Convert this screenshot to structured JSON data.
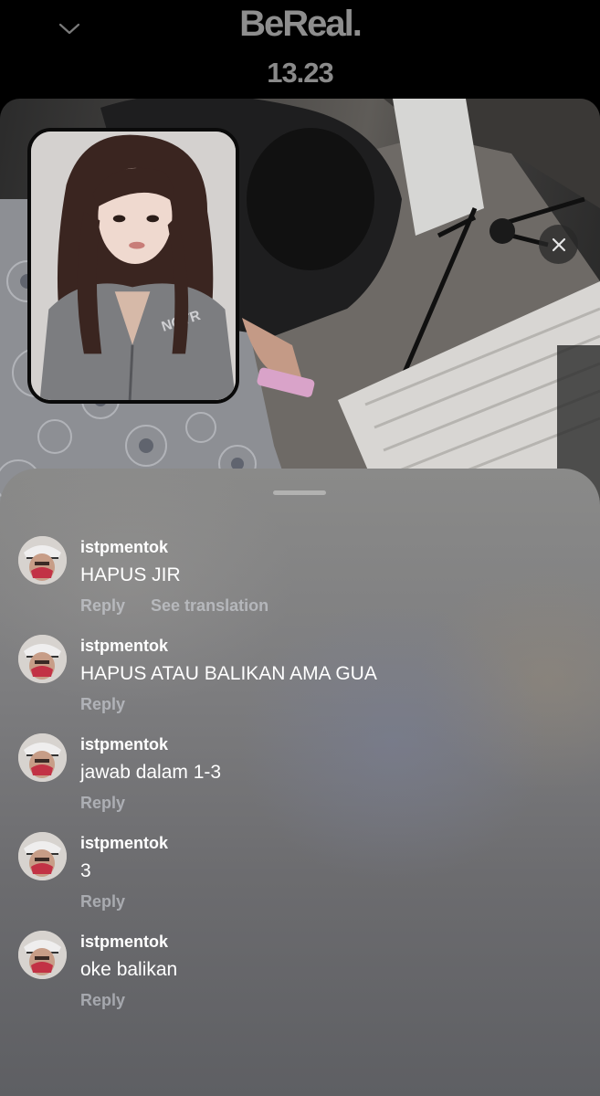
{
  "header": {
    "brand": "BeReal.",
    "time": "13.23",
    "collapse_icon": "chevron-down-icon"
  },
  "photo": {
    "close_icon": "close-icon"
  },
  "comments": [
    {
      "username": "istpmentok",
      "text": "HAPUS JIR",
      "reply": "Reply",
      "translate": "See translation"
    },
    {
      "username": "istpmentok",
      "text": "HAPUS ATAU BALIKAN AMA GUA",
      "reply": "Reply"
    },
    {
      "username": "istpmentok",
      "text": "jawab dalam 1-3",
      "reply": "Reply"
    },
    {
      "username": "istpmentok",
      "text": "3",
      "reply": "Reply"
    },
    {
      "username": "istpmentok",
      "text": "oke balikan",
      "reply": "Reply"
    }
  ],
  "colors": {
    "background": "#000000",
    "brand_text": "#8e8e8e",
    "comment_text": "#ffffff",
    "action_text": "#c8ccd6"
  }
}
